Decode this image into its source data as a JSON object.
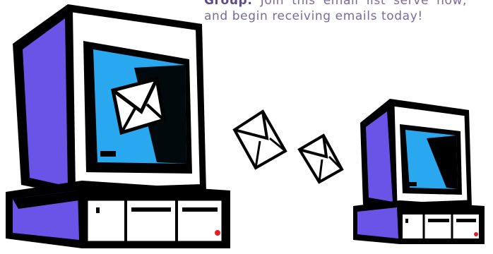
{
  "intro": {
    "group_label": "Group:",
    "text": " Join this email list serve now, and begin receiving emails today!"
  },
  "colors": {
    "outline": "#000000",
    "side_panel": "#6a54e8",
    "screen": "#29a8f0",
    "case": "#ffffff",
    "power_light": "#e02020",
    "text": "#7a6a99"
  },
  "icons": [
    "computer-icon",
    "envelope-icon",
    "envelope-icon",
    "envelope-icon",
    "computer-icon"
  ]
}
